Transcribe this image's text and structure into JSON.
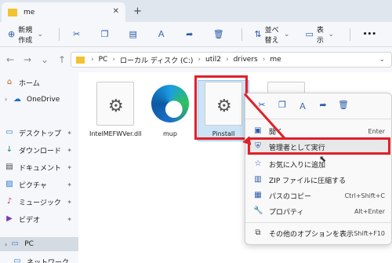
{
  "window": {
    "tab_title": "me",
    "close_glyph": "✕",
    "newtab_glyph": "+"
  },
  "toolbar": {
    "new_label": "新規作成",
    "sort_label": "並べ替え",
    "view_label": "表示",
    "more_label": "•••"
  },
  "address": {
    "crumbs": [
      "PC",
      "ローカル ディスク (C:)",
      "util2",
      "drivers",
      "me"
    ]
  },
  "sidebar": {
    "items": [
      {
        "label": "ホーム",
        "icon": "home-icon"
      },
      {
        "label": "OneDrive",
        "icon": "cloud-icon"
      },
      {
        "label": "デスクトップ",
        "icon": "desktop-icon"
      },
      {
        "label": "ダウンロード",
        "icon": "download-icon"
      },
      {
        "label": "ドキュメント",
        "icon": "document-icon"
      },
      {
        "label": "ピクチャ",
        "icon": "picture-icon"
      },
      {
        "label": "ミュージック",
        "icon": "music-icon"
      },
      {
        "label": "ビデオ",
        "icon": "video-icon"
      },
      {
        "label": "PC",
        "icon": "pc-icon"
      },
      {
        "label": "ネットワーク",
        "icon": "network-icon"
      }
    ]
  },
  "files": [
    {
      "name": "IntelMEFWVer.dll",
      "icon": "gear-file-icon"
    },
    {
      "name": "mup",
      "icon": "edge-icon"
    },
    {
      "name": "Pinstall",
      "icon": "gear-file-icon"
    }
  ],
  "context_menu": {
    "items": [
      {
        "label": "開く",
        "shortcut": "Enter",
        "icon": "open-icon"
      },
      {
        "label": "管理者として実行",
        "shortcut": "",
        "icon": "shield-icon"
      },
      {
        "label": "お気に入りに追加",
        "shortcut": "",
        "icon": "star-icon"
      },
      {
        "label": "ZIP ファイルに圧縮する",
        "shortcut": "",
        "icon": "zip-icon"
      },
      {
        "label": "パスのコピー",
        "shortcut": "Ctrl+Shift+C",
        "icon": "path-icon"
      },
      {
        "label": "プロパティ",
        "shortcut": "Alt+Enter",
        "icon": "wrench-icon"
      },
      {
        "label": "その他のオプションを表示",
        "shortcut": "Shift+F10",
        "icon": "more-options-icon"
      }
    ]
  },
  "colors": {
    "highlight": "#e0202a",
    "accent": "#2a5aa8",
    "folder": "#f2c230"
  }
}
